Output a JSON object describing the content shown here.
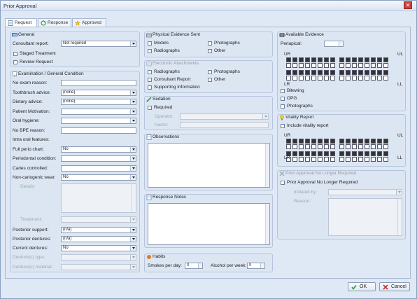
{
  "window": {
    "title": "Prior Approval"
  },
  "tabs": [
    {
      "label": "Request"
    },
    {
      "label": "Response"
    },
    {
      "label": "Approved"
    }
  ],
  "general": {
    "title": "General",
    "consultant_label": "Consultant report:",
    "consultant_value": "Not required",
    "staged": "Staged Treatment",
    "review": "Review Request"
  },
  "exam": {
    "title": "Examination / General Condition",
    "rows": [
      {
        "label": "No exam reason:",
        "value": ""
      },
      {
        "label": "Toothbrush advice:",
        "value": "(none)"
      },
      {
        "label": "Dietary advice:",
        "value": "(none)"
      },
      {
        "label": "Patient Motivation:",
        "value": ""
      },
      {
        "label": "Oral hygiene:",
        "value": ""
      },
      {
        "label": "No BPE reason:",
        "value": ""
      },
      {
        "label": "Intra oral features:",
        "value": ""
      },
      {
        "label": "Full perio chart:",
        "value": "No"
      },
      {
        "label": "Periodontal condition:",
        "value": ""
      },
      {
        "label": "Caries controlled:",
        "value": ""
      },
      {
        "label": "Non-cariogenic wear:",
        "value": "No"
      }
    ],
    "details_label": "Details:",
    "treatment_label": "Treatment:",
    "rows2": [
      {
        "label": "Posterior support:",
        "value": "(n/a)"
      },
      {
        "label": "Posterior dentures:",
        "value": "(n/a)"
      },
      {
        "label": "Current dentures:",
        "value": "No"
      },
      {
        "label": "Denture(s) type:",
        "value": ""
      },
      {
        "label": "Denture(s) material:",
        "value": ""
      }
    ]
  },
  "physical": {
    "title": "Physical Evidence Sent",
    "items": [
      "Models",
      "Photographs",
      "Radiographs",
      "Other"
    ]
  },
  "attachments": {
    "title": "Electronic Attachments",
    "items": [
      "Radiographs",
      "Photographs",
      "Consultant Report",
      "Other",
      "Supporting Information"
    ]
  },
  "sedation": {
    "title": "Sedation",
    "required": "Required",
    "operator": "Operator:",
    "name": "Name:"
  },
  "observations": {
    "title": "Observations"
  },
  "response_notes": {
    "title": "Response Notes"
  },
  "habits": {
    "title": "Habits",
    "smokes_label": "Smokes per day:",
    "smokes_value": "0",
    "alcohol_label": "Alcohol per week:",
    "alcohol_value": "0"
  },
  "available": {
    "title": "Available Evidence",
    "periapical": "Periapical:",
    "ur": "UR",
    "ul": "UL",
    "lr": "LR",
    "ll": "LL",
    "bitewing": "Bitewing",
    "opg": "OPG",
    "photographs": "Photographs"
  },
  "vitality": {
    "title": "Vitality Report",
    "include": "Include vitality report",
    "ur": "UR",
    "ul": "UL",
    "lr": "LR",
    "ll": "LL"
  },
  "nolonger": {
    "title": "Prior Approval No Longer Required",
    "check": "Prior Approval No Longer Required",
    "initiated": "Initiated by:",
    "reason": "Reason:"
  },
  "buttons": {
    "ok": "OK",
    "cancel": "Cancel"
  },
  "colors": {
    "accent": "#3a6ea5",
    "ok": "#2a9a2a",
    "cancel": "#c0302a"
  }
}
